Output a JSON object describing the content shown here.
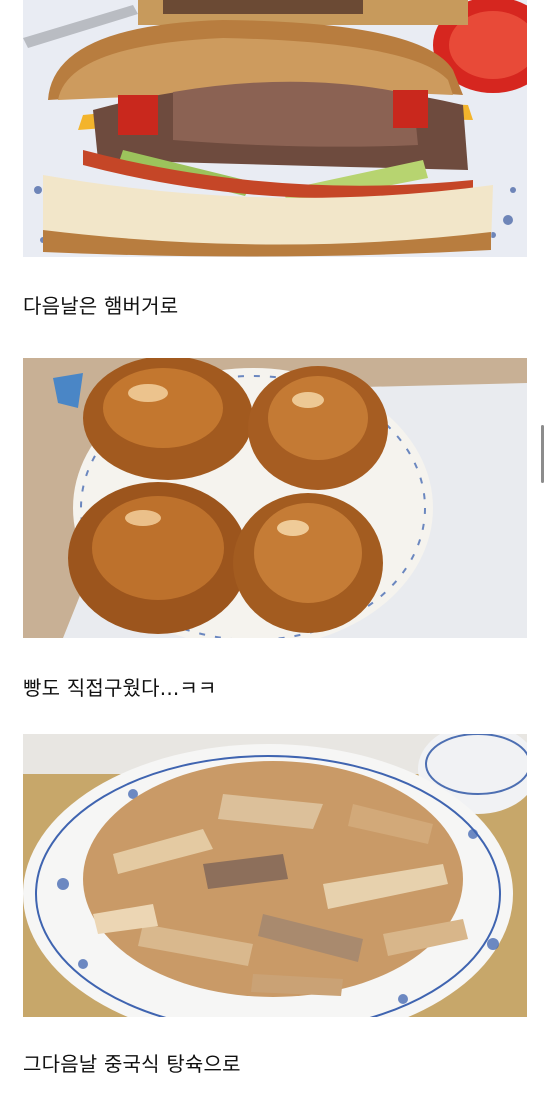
{
  "post": {
    "items": [
      {
        "caption": "다음날은 햄버거로",
        "photo_subject": "hamburger"
      },
      {
        "caption": "빵도 직접구웠다...ㅋㅋ",
        "photo_subject": "homemade-buns"
      },
      {
        "caption": "그다음날 중국식 탕슉으로",
        "photo_subject": "sweet-and-sour-pork"
      }
    ]
  },
  "colors": {
    "background": "#ffffff",
    "text": "#111111",
    "scrollbar": "#8c8c8c"
  }
}
